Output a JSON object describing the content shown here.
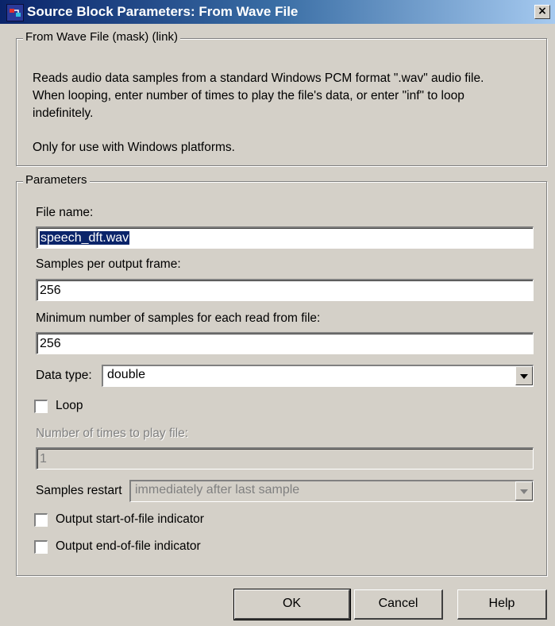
{
  "window": {
    "title": "Source Block Parameters: From Wave File",
    "close_label": "×"
  },
  "mask": {
    "legend": "From Wave File (mask) (link)",
    "description_lines": [
      "Reads audio data samples from a standard Windows PCM format \".wav\" audio file.",
      "When looping, enter number of times to play the file's data, or enter \"inf\" to loop",
      "indefinitely."
    ],
    "note": "Only for use with Windows platforms."
  },
  "params": {
    "legend": "Parameters",
    "file_name_label": "File name:",
    "file_name_value": "speech_dft.wav",
    "samples_per_frame_label": "Samples per output frame:",
    "samples_per_frame_value": "256",
    "min_samples_label": "Minimum number of samples for each read from file:",
    "min_samples_value": "256",
    "data_type_label": "Data type:",
    "data_type_value": "double",
    "loop_label": "Loop",
    "loop_checked": false,
    "num_times_label": "Number of times to play file:",
    "num_times_value": "1",
    "samples_restart_label": "Samples restart",
    "samples_restart_value": "immediately after last sample",
    "start_indicator_label": "Output start-of-file indicator",
    "start_indicator_checked": false,
    "end_indicator_label": "Output end-of-file indicator",
    "end_indicator_checked": false
  },
  "buttons": {
    "ok": "OK",
    "cancel": "Cancel",
    "help": "Help"
  }
}
